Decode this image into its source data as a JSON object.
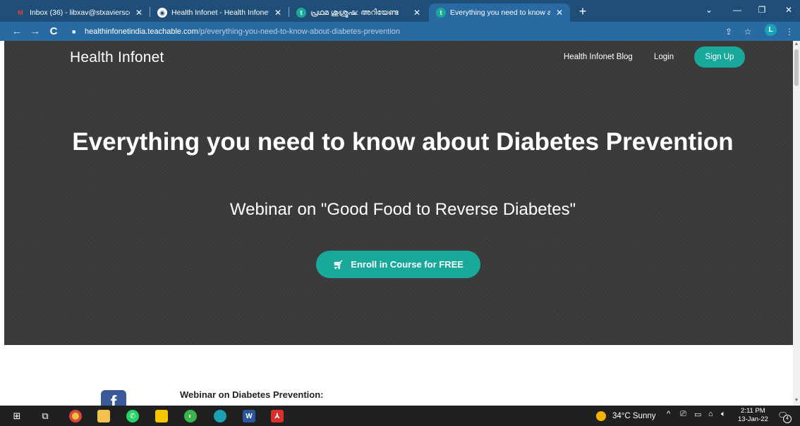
{
  "browser": {
    "tabs": [
      {
        "title": "Inbox (36) - libxav@stxavierscolle",
        "icon": "gmail-icon",
        "active": false
      },
      {
        "title": "Health Infonet - Health Infonet, I",
        "icon": "globe-icon",
        "active": false
      },
      {
        "title": "പ്രഥമ ശുശ്രൂഷ: അറിയേണ്ട",
        "icon": "teachable-icon",
        "active": false
      },
      {
        "title": "Everything you need to know abo",
        "icon": "teachable-icon",
        "active": true
      }
    ],
    "new_tab_symbol": "+",
    "address": {
      "host": "healthinfonetindia.teachable.com",
      "path": "/p/everything-you-need-to-know-about-diabetes-prevention"
    },
    "profile_initial": "L"
  },
  "site": {
    "brand": "Health Infonet",
    "nav": {
      "blog": "Health Infonet Blog",
      "login": "Login",
      "signup": "Sign Up"
    }
  },
  "hero": {
    "title": "Everything you need to know about Diabetes Prevention",
    "subtitle": "Webinar on \"Good Food to Reverse Diabetes\"",
    "enroll_label": "Enroll in Course for FREE"
  },
  "content": {
    "heading": "Webinar on Diabetes Prevention:"
  },
  "taskbar": {
    "weather": "34°C  Sunny",
    "time": "2:11 PM",
    "date": "13-Jan-22",
    "notification_count": "4"
  },
  "colors": {
    "tabstrip": "#1f4e79",
    "toolbar": "#2a6aa2",
    "hero_bg": "#3b3b3b",
    "accent_teal": "#18a99b",
    "taskbar": "#202020"
  }
}
